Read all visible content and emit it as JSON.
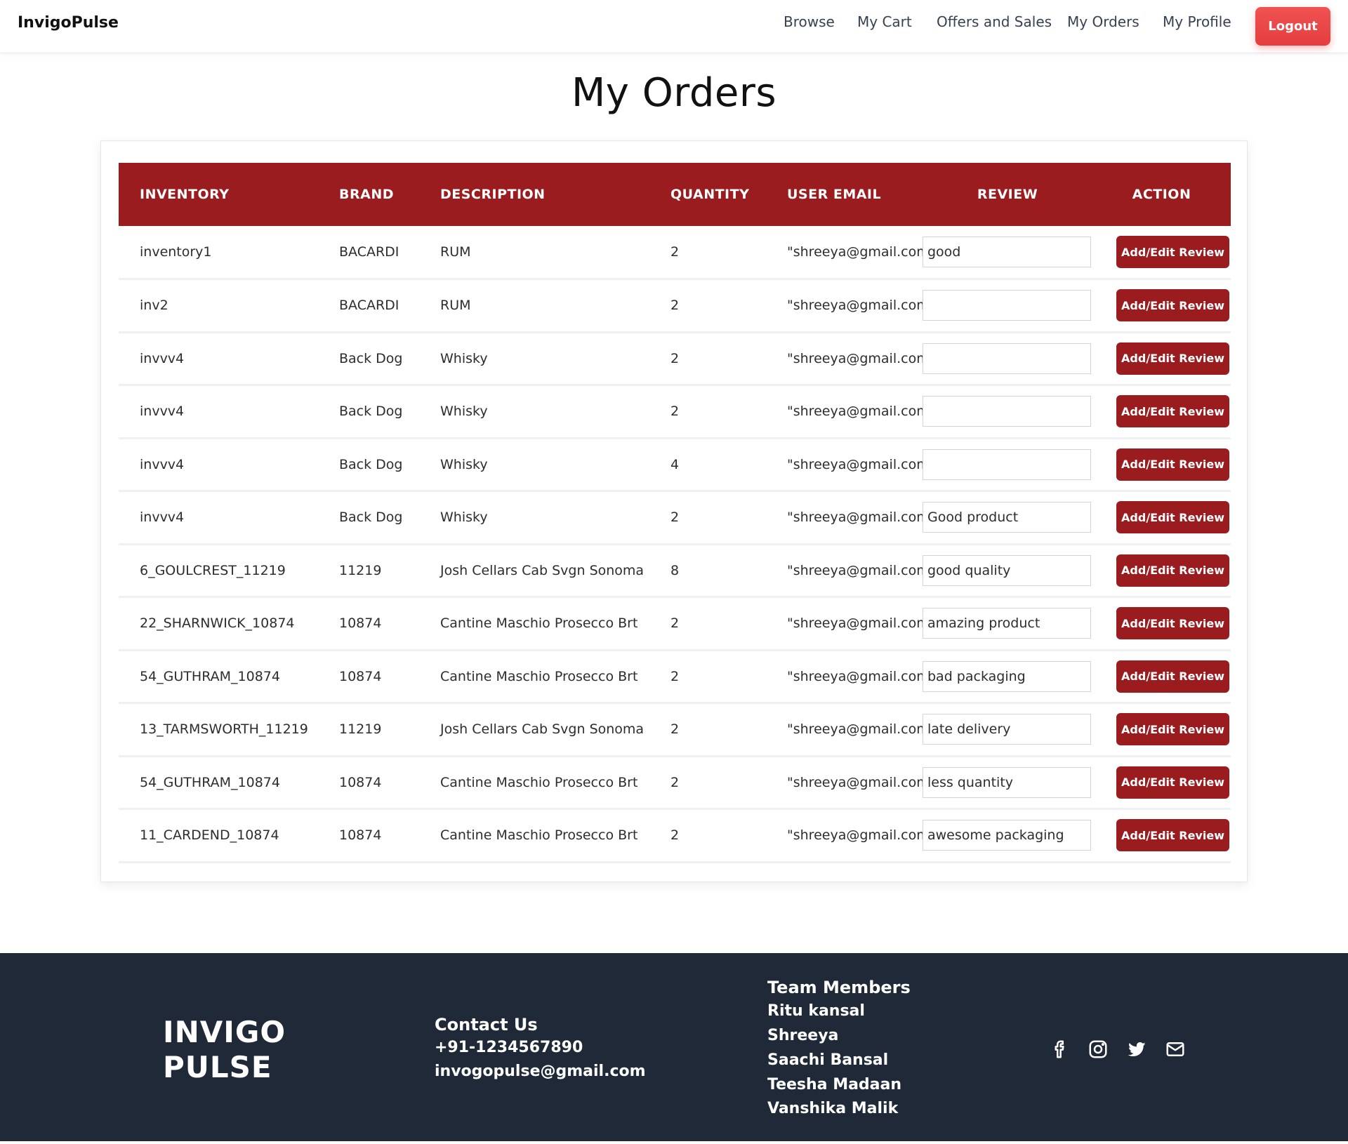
{
  "navbar": {
    "brand": "InvigoPulse",
    "links": [
      "Browse",
      "My Cart",
      "Offers and Sales",
      "My Orders",
      "My Profile"
    ],
    "logout_label": "Logout"
  },
  "page": {
    "title": "My Orders"
  },
  "table": {
    "headers": [
      "INVENTORY",
      "BRAND",
      "DESCRIPTION",
      "QUANTITY",
      "USER EMAIL",
      "REVIEW",
      "ACTION"
    ],
    "action_label": "Add/Edit Review",
    "rows": [
      {
        "inventory": "inventory1",
        "brand": "BACARDI",
        "description": "RUM",
        "quantity": "2",
        "email": "\"shreeya@gmail.com\"",
        "review": "good"
      },
      {
        "inventory": "inv2",
        "brand": "BACARDI",
        "description": "RUM",
        "quantity": "2",
        "email": "\"shreeya@gmail.com\"",
        "review": ""
      },
      {
        "inventory": "invvv4",
        "brand": "Back Dog",
        "description": "Whisky",
        "quantity": "2",
        "email": "\"shreeya@gmail.com\"",
        "review": ""
      },
      {
        "inventory": "invvv4",
        "brand": "Back Dog",
        "description": "Whisky",
        "quantity": "2",
        "email": "\"shreeya@gmail.com\"",
        "review": ""
      },
      {
        "inventory": "invvv4",
        "brand": "Back Dog",
        "description": "Whisky",
        "quantity": "4",
        "email": "\"shreeya@gmail.com\"",
        "review": ""
      },
      {
        "inventory": "invvv4",
        "brand": "Back Dog",
        "description": "Whisky",
        "quantity": "2",
        "email": "\"shreeya@gmail.com\"",
        "review": "Good product"
      },
      {
        "inventory": "6_GOULCREST_11219",
        "brand": "11219",
        "description": "Josh Cellars Cab Svgn Sonoma",
        "quantity": "8",
        "email": "\"shreeya@gmail.com\"",
        "review": "good quality"
      },
      {
        "inventory": "22_SHARNWICK_10874",
        "brand": "10874",
        "description": "Cantine Maschio Prosecco Brt",
        "quantity": "2",
        "email": "\"shreeya@gmail.com\"",
        "review": "amazing product"
      },
      {
        "inventory": "54_GUTHRAM_10874",
        "brand": "10874",
        "description": "Cantine Maschio Prosecco Brt",
        "quantity": "2",
        "email": "\"shreeya@gmail.com\"",
        "review": "bad packaging"
      },
      {
        "inventory": "13_TARMSWORTH_11219",
        "brand": "11219",
        "description": "Josh Cellars Cab Svgn Sonoma",
        "quantity": "2",
        "email": "\"shreeya@gmail.com\"",
        "review": "late delivery"
      },
      {
        "inventory": "54_GUTHRAM_10874",
        "brand": "10874",
        "description": "Cantine Maschio Prosecco Brt",
        "quantity": "2",
        "email": "\"shreeya@gmail.com\"",
        "review": "less quantity"
      },
      {
        "inventory": "11_CARDEND_10874",
        "brand": "10874",
        "description": "Cantine Maschio Prosecco Brt",
        "quantity": "2",
        "email": "\"shreeya@gmail.com\"",
        "review": "awesome packaging"
      }
    ]
  },
  "footer": {
    "logo_line1": "INVIGO",
    "logo_line2": "PULSE",
    "contact_heading": "Contact Us",
    "phone": "+91-1234567890",
    "email": "invogopulse@gmail.com",
    "team_heading": "Team Members",
    "team": [
      "Ritu kansal",
      "Shreeya",
      "Saachi Bansal",
      "Teesha Madaan",
      "Vanshika Malik"
    ],
    "social_icons": [
      "facebook-icon",
      "instagram-icon",
      "twitter-icon",
      "mail-icon"
    ]
  },
  "colors": {
    "header_red": "#9b1c1f",
    "logout_red": "#ef4444",
    "footer_bg": "#1f2937"
  }
}
